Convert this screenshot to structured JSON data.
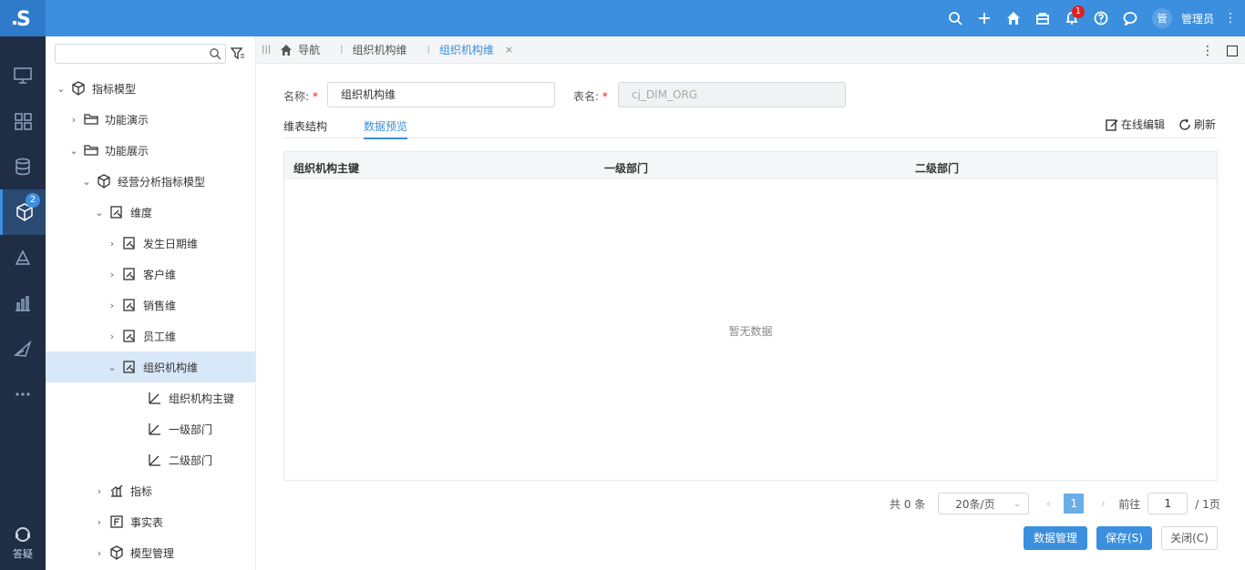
{
  "topbar": {
    "logo_letter": "S",
    "notifications_count": "1",
    "user_avatar": "管",
    "user_name": "管理员",
    "icons": [
      "search-icon",
      "plus-icon",
      "home-icon",
      "package-icon",
      "bell-icon",
      "help-icon",
      "chat-icon"
    ]
  },
  "leftnav": {
    "items": [
      "monitor-icon",
      "apps-icon",
      "database-icon",
      "model-icon",
      "layers-icon",
      "chart-icon",
      "send-icon",
      "more-icon"
    ],
    "active_badge": "2",
    "help_label": "答疑"
  },
  "tree": {
    "search_placeholder": "",
    "nodes": [
      {
        "label": "指标模型",
        "arrow": "⌄",
        "icon": "cube-icon"
      },
      {
        "label": "功能演示",
        "arrow": "›",
        "icon": "folder-icon"
      },
      {
        "label": "功能展示",
        "arrow": "⌄",
        "icon": "folder-icon"
      },
      {
        "label": "经营分析指标模型",
        "arrow": "⌄",
        "icon": "cube-icon"
      },
      {
        "label": "维度",
        "arrow": "⌄",
        "icon": "dimension-icon"
      },
      {
        "label": "发生日期维",
        "arrow": "›",
        "icon": "dimension-icon"
      },
      {
        "label": "客户维",
        "arrow": "›",
        "icon": "dimension-icon"
      },
      {
        "label": "销售维",
        "arrow": "›",
        "icon": "dimension-icon"
      },
      {
        "label": "员工维",
        "arrow": "›",
        "icon": "dimension-icon"
      },
      {
        "label": "组织机构维",
        "arrow": "⌄",
        "icon": "dimension-icon"
      },
      {
        "label": "组织机构主键",
        "arrow": "",
        "icon": "level-icon"
      },
      {
        "label": "一级部门",
        "arrow": "",
        "icon": "level-icon"
      },
      {
        "label": "二级部门",
        "arrow": "",
        "icon": "level-icon"
      },
      {
        "label": "指标",
        "arrow": "›",
        "icon": "metrics-icon"
      },
      {
        "label": "事实表",
        "arrow": "›",
        "icon": "fact-table-icon"
      },
      {
        "label": "模型管理",
        "arrow": "›",
        "icon": "cube-icon"
      }
    ]
  },
  "tabs": {
    "nav_label": "导航",
    "tab1": "组织机构维",
    "tab2": "组织机构维",
    "tab2_close": "×"
  },
  "form": {
    "name_label": "名称:",
    "name_value": "组织机构维",
    "table_label": "表名:",
    "table_value": "cj_DIM_ORG",
    "required_mark": "*"
  },
  "subtabs": {
    "structure": "维表结构",
    "preview": "数据预览",
    "edit": "在线编辑",
    "refresh": "刷新"
  },
  "grid": {
    "columns": [
      "组织机构主键",
      "一级部门",
      "二级部门"
    ],
    "empty_text": "暂无数据"
  },
  "pager": {
    "total": "共 0 条",
    "page_size": "20条/页",
    "current_page": "1",
    "goto_label": "前往",
    "goto_value": "1",
    "total_pages": "/ 1页"
  },
  "buttons": {
    "data_manage": "数据管理",
    "save": "保存(S)",
    "close": "关闭(C)"
  }
}
